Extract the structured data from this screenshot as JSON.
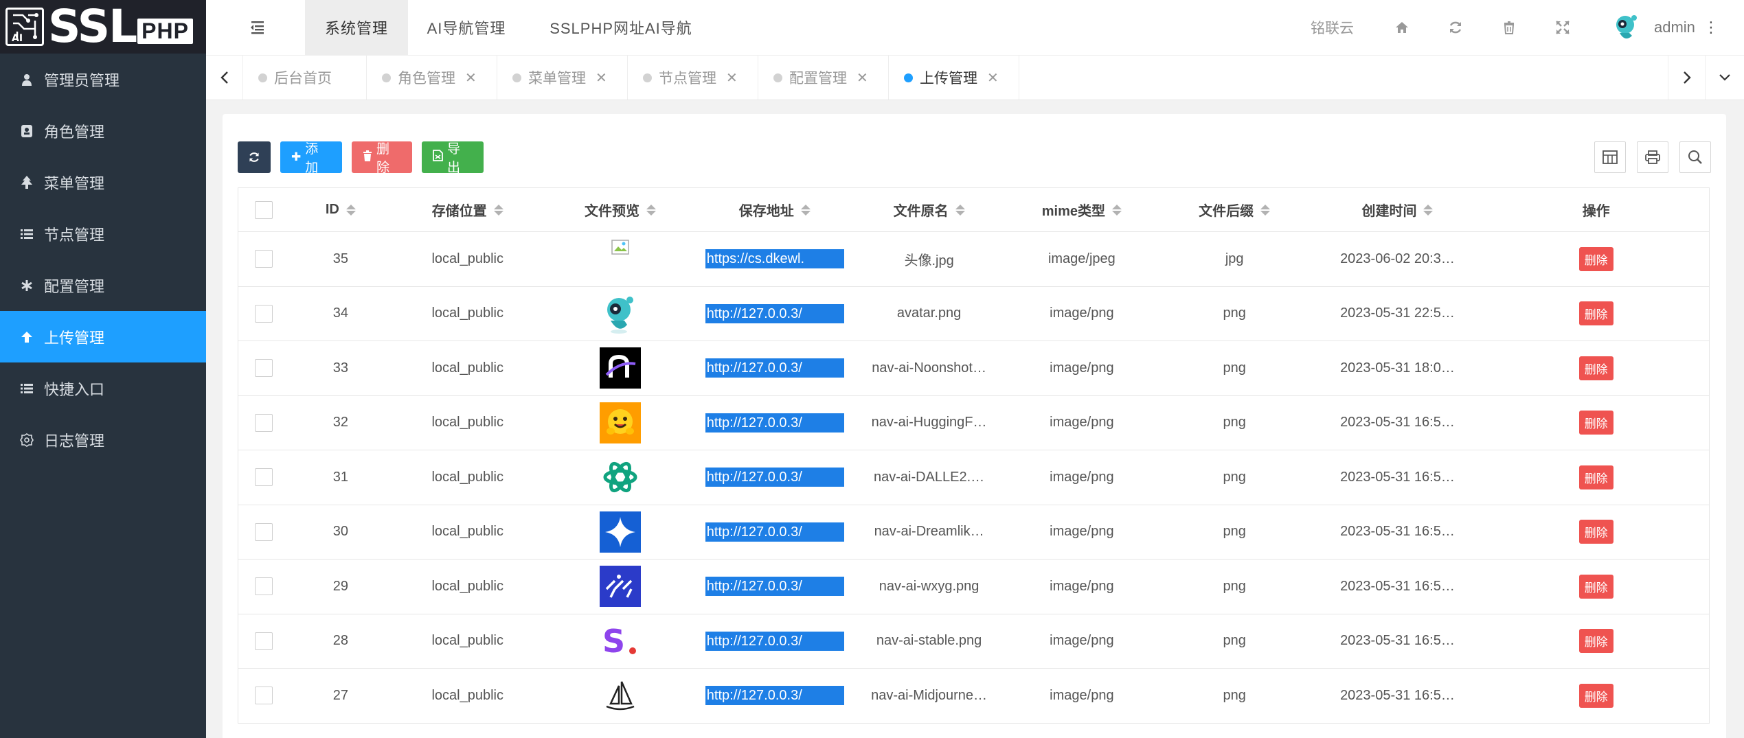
{
  "app": {
    "logo_text": "SSL",
    "logo_badge": "PHP",
    "logo_chip_text": "AI"
  },
  "sidebar": {
    "items": [
      {
        "label": "管理员管理",
        "icon": "user-icon"
      },
      {
        "label": "角色管理",
        "icon": "shield-icon"
      },
      {
        "label": "菜单管理",
        "icon": "tree-icon"
      },
      {
        "label": "节点管理",
        "icon": "list-icon"
      },
      {
        "label": "配置管理",
        "icon": "asterisk-icon"
      },
      {
        "label": "上传管理",
        "icon": "arrow-up-icon",
        "active": true
      },
      {
        "label": "快捷入口",
        "icon": "list-icon"
      },
      {
        "label": "日志管理",
        "icon": "gear-icon"
      }
    ]
  },
  "header": {
    "tabs": [
      {
        "label": "系统管理",
        "active": true
      },
      {
        "label": "AI导航管理"
      },
      {
        "label": "SSLPHP网址AI导航"
      }
    ],
    "site_name": "铭联云",
    "admin_name": "admin",
    "kebab": "⋮"
  },
  "pagetabs": [
    {
      "label": "后台首页",
      "closable": false
    },
    {
      "label": "角色管理",
      "closable": true
    },
    {
      "label": "菜单管理",
      "closable": true
    },
    {
      "label": "节点管理",
      "closable": true
    },
    {
      "label": "配置管理",
      "closable": true
    },
    {
      "label": "上传管理",
      "closable": true,
      "active": true
    }
  ],
  "toolbar": {
    "refresh_label": "",
    "add_label": "添加",
    "delete_label": "删除",
    "export_label": "导出"
  },
  "table": {
    "columns": [
      "ID",
      "存储位置",
      "文件预览",
      "保存地址",
      "文件原名",
      "mime类型",
      "文件后缀",
      "创建时间",
      "操作"
    ],
    "delete_label": "删除",
    "rows": [
      {
        "id": "35",
        "loc": "local_public",
        "preview": "broken-image",
        "url": "https://cs.dkewl.",
        "name": "头像.jpg",
        "mime": "image/jpeg",
        "ext": "jpg",
        "time": "2023-06-02 20:3…"
      },
      {
        "id": "34",
        "loc": "local_public",
        "preview": "robot-avatar",
        "url": "http://127.0.0.3/",
        "name": "avatar.png",
        "mime": "image/png",
        "ext": "png",
        "time": "2023-05-31 22:5…"
      },
      {
        "id": "33",
        "loc": "local_public",
        "preview": "noonshot-logo",
        "url": "http://127.0.0.3/",
        "name": "nav-ai-Noonshot…",
        "mime": "image/png",
        "ext": "png",
        "time": "2023-05-31 18:0…"
      },
      {
        "id": "32",
        "loc": "local_public",
        "preview": "huggingface-logo",
        "url": "http://127.0.0.3/",
        "name": "nav-ai-HuggingF…",
        "mime": "image/png",
        "ext": "png",
        "time": "2023-05-31 16:5…"
      },
      {
        "id": "31",
        "loc": "local_public",
        "preview": "openai-logo",
        "url": "http://127.0.0.3/",
        "name": "nav-ai-DALLE2.…",
        "mime": "image/png",
        "ext": "png",
        "time": "2023-05-31 16:5…"
      },
      {
        "id": "30",
        "loc": "local_public",
        "preview": "dreamlike-logo",
        "url": "http://127.0.0.3/",
        "name": "nav-ai-Dreamlik…",
        "mime": "image/png",
        "ext": "png",
        "time": "2023-05-31 16:5…"
      },
      {
        "id": "29",
        "loc": "local_public",
        "preview": "wxyg-logo",
        "url": "http://127.0.0.3/",
        "name": "nav-ai-wxyg.png",
        "mime": "image/png",
        "ext": "png",
        "time": "2023-05-31 16:5…"
      },
      {
        "id": "28",
        "loc": "local_public",
        "preview": "stable-logo",
        "url": "http://127.0.0.3/",
        "name": "nav-ai-stable.png",
        "mime": "image/png",
        "ext": "png",
        "time": "2023-05-31 16:5…"
      },
      {
        "id": "27",
        "loc": "local_public",
        "preview": "midjourney-logo",
        "url": "http://127.0.0.3/",
        "name": "nav-ai-Midjourne…",
        "mime": "image/png",
        "ext": "png",
        "time": "2023-05-31 16:5…"
      }
    ]
  },
  "colors": {
    "sidebar_bg": "#28333e",
    "accent": "#1e9fff",
    "danger": "#ef5350",
    "success": "#43b04c",
    "dark_button": "#2f4056"
  }
}
